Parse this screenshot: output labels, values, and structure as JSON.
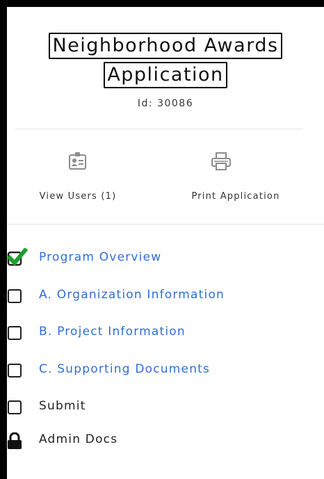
{
  "header": {
    "title_line1": "Neighborhood Awards",
    "title_line2": "Application",
    "id_text": "Id: 30086"
  },
  "actions": {
    "view_users": {
      "label": "View Users (1)",
      "icon": "id-card-icon"
    },
    "print": {
      "label": "Print Application",
      "icon": "printer-icon"
    }
  },
  "nav": {
    "items": [
      {
        "label": "Program Overview",
        "state": "checked",
        "style": "link"
      },
      {
        "label": "A. Organization Information",
        "state": "unchecked",
        "style": "link"
      },
      {
        "label": "B. Project Information",
        "state": "unchecked",
        "style": "link"
      },
      {
        "label": "C. Supporting Documents",
        "state": "unchecked",
        "style": "link"
      },
      {
        "label": "Submit",
        "state": "unchecked",
        "style": "plain"
      },
      {
        "label": "Admin Docs",
        "state": "locked",
        "style": "plain"
      }
    ]
  },
  "colors": {
    "link": "#2f6fd6",
    "check": "#1f9d2e",
    "icon_gray": "#8c8c8c"
  }
}
